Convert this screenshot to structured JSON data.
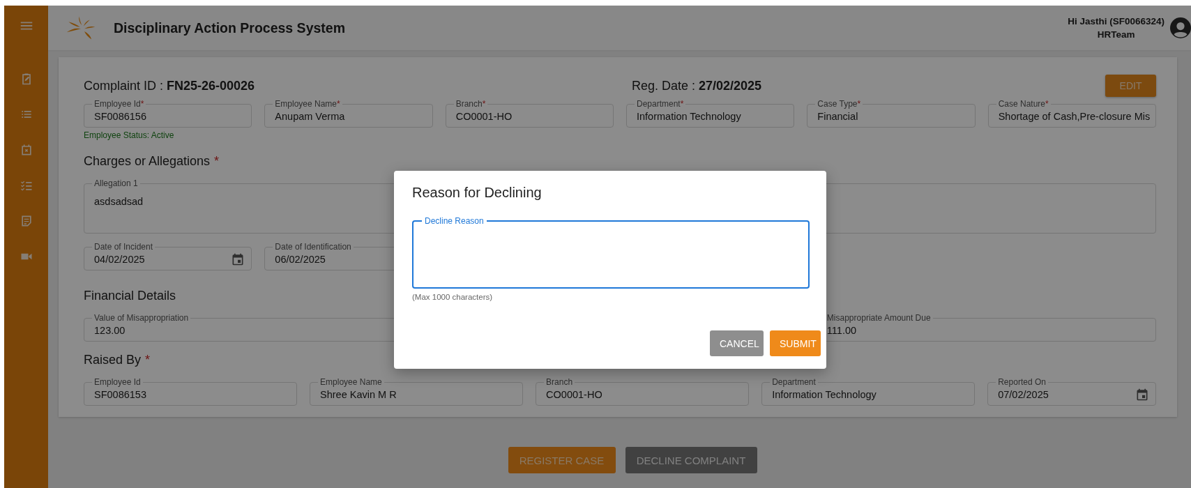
{
  "header": {
    "title": "Disciplinary Action Process System",
    "greeting": "Hi Jasthi (SF0066324)",
    "role": "HRTeam"
  },
  "complaint": {
    "id_label": "Complaint ID :",
    "id": "FN25-26-00026",
    "date_label": "Reg. Date :",
    "date": "27/02/2025",
    "edit_button": "EDIT"
  },
  "employee_fields": [
    {
      "label": "Employee Id",
      "value": "SF0086156",
      "required_mark": "*"
    },
    {
      "label": "Employee Name",
      "value": "Anupam Verma",
      "required_mark": "*"
    },
    {
      "label": "Branch",
      "value": "CO0001-HO",
      "required_mark": "*"
    },
    {
      "label": "Department",
      "value": "Information Technology",
      "required_mark": "*"
    },
    {
      "label": "Case Type",
      "value": "Financial",
      "required_mark": "*"
    },
    {
      "label": "Case Nature",
      "value": "Shortage of Cash,Pre-closure Mis",
      "required_mark": "*"
    }
  ],
  "employee_status": "Employee Status: Active",
  "allegations": {
    "heading": "Charges or Allegations",
    "required_mark": "*",
    "items": [
      {
        "label": "Allegation 1",
        "value": "asdsadsad"
      }
    ]
  },
  "dates": [
    {
      "label": "Date of Incident",
      "value": "04/02/2025",
      "calendar": true
    },
    {
      "label": "Date of Identification",
      "value": "06/02/2025"
    }
  ],
  "financial": {
    "heading": "Financial Details",
    "fields": [
      {
        "label": "Value of Misappropriation",
        "value": "123.00"
      },
      {
        "label": "Misappropriate Amount Due",
        "value": "111.00"
      }
    ]
  },
  "raised_by": {
    "heading": "Raised By",
    "required_mark": "*",
    "fields": [
      {
        "label": "Employee Id",
        "value": "SF0086153",
        "calendar": false
      },
      {
        "label": "Employee Name",
        "value": "Shree Kavin M R",
        "calendar": false
      },
      {
        "label": "Branch",
        "value": "CO0001-HO",
        "calendar": false
      },
      {
        "label": "Department",
        "value": "Information Technology",
        "calendar": false
      },
      {
        "label": "Reported On",
        "value": "07/02/2025",
        "calendar": true
      }
    ]
  },
  "actions": [
    {
      "label": "REGISTER CASE",
      "kind": "primary"
    },
    {
      "label": "DECLINE COMPLAINT",
      "kind": "dark"
    }
  ],
  "dialog": {
    "title": "Reason for Declining",
    "field": {
      "label": "Decline Reason",
      "focused": true
    },
    "helper": "(Max 1000 characters)",
    "buttons": [
      {
        "label": "CANCEL",
        "kind": "secondary"
      },
      {
        "label": "SUBMIT",
        "kind": "primary"
      }
    ]
  }
}
